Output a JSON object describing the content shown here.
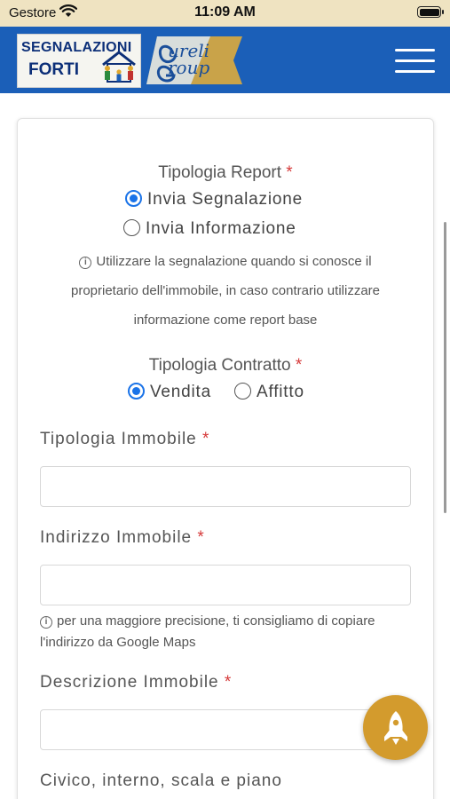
{
  "status_bar": {
    "carrier": "Gestore",
    "time": "11:09 AM"
  },
  "header": {
    "logo_left_line1": "SEGNALAZIONI",
    "logo_left_line2": "FORTI",
    "logo_right_line1": "ureli",
    "logo_right_line2": "roup",
    "menu_icon": "hamburger-menu-icon",
    "colors": {
      "bar": "#1b5fb8",
      "logo_gold": "#c9a349"
    }
  },
  "form": {
    "report_type": {
      "label": "Tipologia Report",
      "required_mark": "*",
      "options": [
        {
          "label": "Invia Segnalazione",
          "selected": true
        },
        {
          "label": "Invia Informazione",
          "selected": false
        }
      ]
    },
    "report_info": {
      "line1": "Utilizzare la segnalazione quando si conosce il",
      "line2": "proprietario dell'immobile, in caso contrario utilizzare",
      "line3": "informazione come report base"
    },
    "contract_type": {
      "label": "Tipologia Contratto",
      "required_mark": "*",
      "options": [
        {
          "label": "Vendita",
          "selected": true
        },
        {
          "label": "Affitto",
          "selected": false
        }
      ]
    },
    "property_type": {
      "label": "Tipologia Immobile",
      "required_mark": "*",
      "value": ""
    },
    "property_address": {
      "label": "Indirizzo Immobile",
      "required_mark": "*",
      "value": "",
      "hint_line1": "per una maggiore precisione, ti consigliamo di copiare",
      "hint_line2": "l'indirizzo da Google Maps"
    },
    "property_description": {
      "label": "Descrizione Immobile",
      "required_mark": "*",
      "value": ""
    },
    "civic_details": {
      "label": "Civico, interno, scala e piano"
    }
  },
  "fab": {
    "icon": "rocket-icon",
    "color": "#d39b2d"
  },
  "colors": {
    "accent": "#1a73e8",
    "required": "#d63a3a"
  }
}
